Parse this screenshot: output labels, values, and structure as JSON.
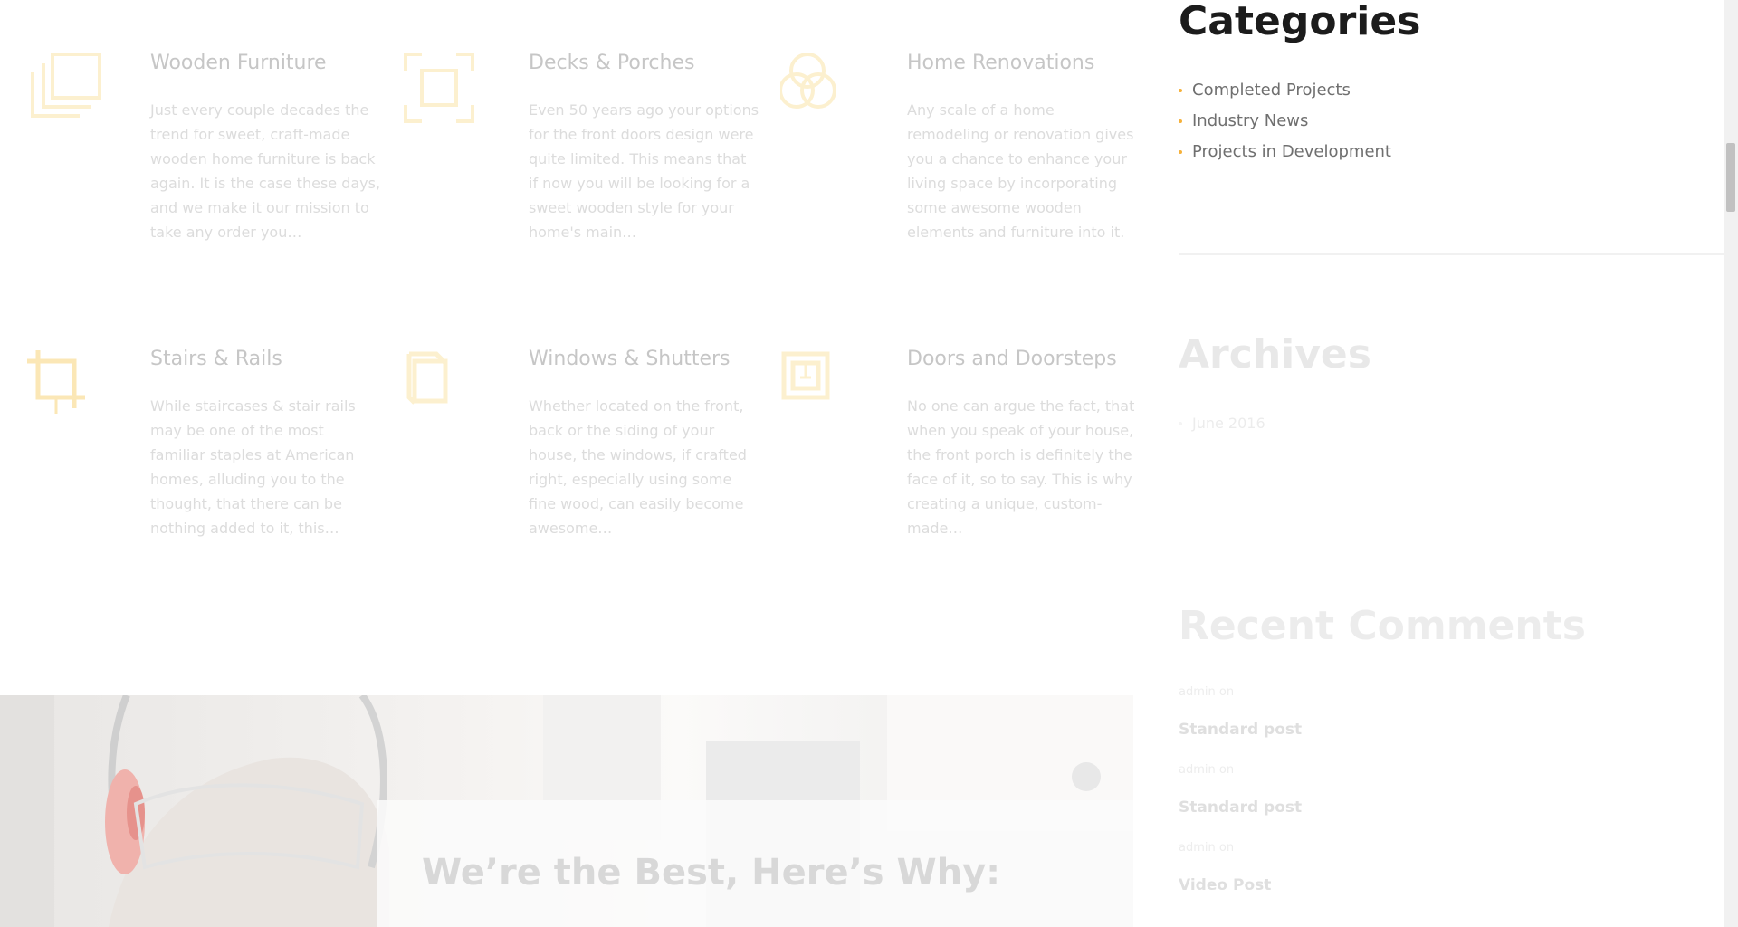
{
  "colors": {
    "accent": "#f6b13a",
    "accent_faded": "#fbe7b6",
    "icon_faded": "#fcf0cf",
    "heading_dark": "#1c1c1c",
    "text_muted": "#6f6f6f"
  },
  "services": [
    {
      "icon": "layers-icon",
      "title": "Wooden Furniture",
      "text": "Just every couple decades the trend for sweet, craft-made wooden home furniture is back again. It is the case these days, and we make it our mission to take any order you…"
    },
    {
      "icon": "focus-frame-icon",
      "title": "Decks & Porches",
      "text": "Even 50 years ago your options for the front doors design were quite limited. This means that if now you will be looking for a sweet wooden style for your home's main…"
    },
    {
      "icon": "circles-icon",
      "title": "Home Renovations",
      "text": "Any scale of a home remodeling or renovation gives you a chance to enhance your living space by incorporating some awesome wooden elements and furniture into it."
    },
    {
      "icon": "crop-icon",
      "title": "Stairs & Rails",
      "text": "While staircases & stair rails may be one of the most familiar staples at American homes, alluding you to the thought, that there can be nothing added to it, this…"
    },
    {
      "icon": "copy-icon",
      "title": "Windows & Shutters",
      "text": "Whether located on the front, back or the siding of your house, the windows, if crafted right, especially using some fine wood, can easily become awesome…"
    },
    {
      "icon": "door-frame-icon",
      "title": "Doors and Doorsteps",
      "text": "No one can argue the fact, that when you speak of your house, the front porch is definitely the face of it, so to say. This is why creating a unique, custom-made…"
    }
  ],
  "banner": {
    "title": "We’re the Best, Here’s Why:"
  },
  "sidebar": {
    "categories": {
      "title": "Categories",
      "items": [
        "Completed Projects",
        "Industry News",
        "Projects in Development"
      ]
    },
    "archives": {
      "title": "Archives",
      "items": [
        "June 2016"
      ]
    },
    "recent_comments": {
      "title": "Recent Comments",
      "items": [
        {
          "meta": "admin on",
          "post": "Standard post"
        },
        {
          "meta": "admin on",
          "post": "Standard post"
        },
        {
          "meta": "admin on",
          "post": "Video Post"
        }
      ]
    }
  }
}
